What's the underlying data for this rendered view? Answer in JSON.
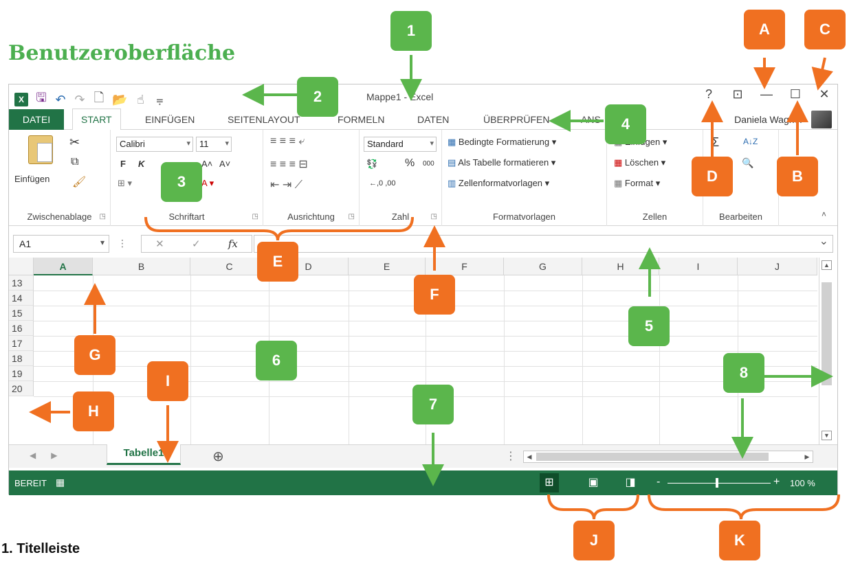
{
  "heading": "Benutzeroberfläche",
  "footnote": "1.  Titelleiste",
  "quick_access": {
    "app_icon": "excel-icon",
    "items": [
      "save-icon",
      "undo-icon",
      "redo-icon",
      "new-document-icon",
      "open-folder-icon",
      "touch-mode-icon",
      "customize-dropdown-icon"
    ]
  },
  "title": "Mappe1 - Excel",
  "window_controls": {
    "help": "?",
    "ribbon_display": "⊡",
    "minimize": "—",
    "maximize": "☐",
    "close": "✕"
  },
  "tabs": {
    "file": "DATEI",
    "start": "START",
    "insert": "EINFÜGEN",
    "page_layout": "SEITENLAYOUT",
    "formulas": "FORMELN",
    "data": "DATEN",
    "review": "ÜBERPRÜFEN",
    "view": "ANS"
  },
  "user_name": "Daniela Wagner",
  "ribbon": {
    "clipboard": {
      "paste": "Einfügen",
      "label": "Zwischenablage"
    },
    "font": {
      "name": "Calibri",
      "size": "11",
      "bold": "F",
      "italic": "K",
      "grow": "A˄",
      "shrink": "A˅",
      "label": "Schriftart"
    },
    "alignment": {
      "label": "Ausrichtung"
    },
    "number": {
      "format": "Standard",
      "percent": "%",
      "thousands": "000",
      "decimals": "←,0  ,00",
      "label": "Zahl"
    },
    "styles": {
      "conditional": "Bedingte Formatierung",
      "as_table": "Als Tabelle formatieren",
      "cell_styles": "Zellenformatvorlagen",
      "label": "Formatvorlagen"
    },
    "cells": {
      "insert": "Einfügen",
      "delete": "Löschen",
      "format": "Format",
      "label": "Zellen"
    },
    "editing": {
      "sum": "Σ",
      "sort": "A↓Z",
      "find": "🔍",
      "label": "Bearbeiten"
    }
  },
  "formula_bar": {
    "name_box": "A1",
    "separator": "⋮",
    "cancel": "✕",
    "enter": "✓",
    "fx": "fx"
  },
  "columns": [
    "A",
    "B",
    "C",
    "D",
    "E",
    "F",
    "G",
    "H",
    "I",
    "J"
  ],
  "rows": [
    "13",
    "14",
    "15",
    "16",
    "17",
    "18",
    "19",
    "20"
  ],
  "sheet": {
    "tab": "Tabelle1",
    "add": "⊕",
    "nav_prev": "◀",
    "nav_next": "▶"
  },
  "status": {
    "ready": "BEREIT",
    "zoom_minus": "-",
    "zoom_plus": "+",
    "zoom": "100 %"
  },
  "callouts": {
    "green": [
      "1",
      "2",
      "3",
      "4",
      "5",
      "6",
      "7",
      "8"
    ],
    "orange": [
      "A",
      "B",
      "C",
      "D",
      "E",
      "F",
      "G",
      "H",
      "I",
      "J",
      "K"
    ]
  },
  "colors": {
    "excel_green": "#217346",
    "callout_green": "#5bb64c",
    "callout_orange": "#f07021",
    "heading_green": "#4caf50"
  }
}
